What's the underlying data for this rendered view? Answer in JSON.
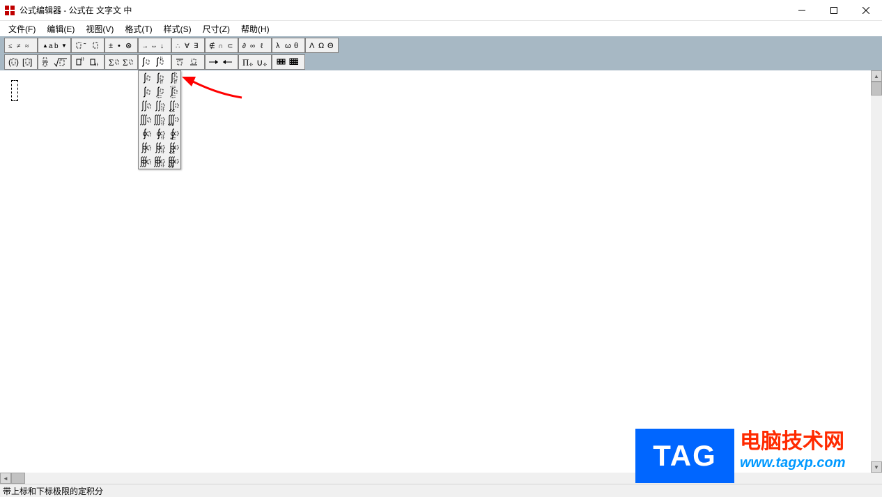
{
  "window": {
    "title": "公式编辑器 - 公式在 文字文 中"
  },
  "menus": {
    "file": "文件(F)",
    "edit": "编辑(E)",
    "view": "视图(V)",
    "format": "格式(T)",
    "style": "样式(S)",
    "size": "尺寸(Z)",
    "help": "帮助(H)"
  },
  "status": {
    "text": "带上标和下标极限的定积分"
  },
  "watermark": {
    "tag": "TAG",
    "line1": "电脑技术网",
    "line2": "www.tagxp.com"
  },
  "toolbars": {
    "row1": [
      "relational-symbols",
      "spacing-ellipsis",
      "embellishments",
      "operators",
      "arrows",
      "logical",
      "set-theory",
      "misc-symbols",
      "greek-lower",
      "greek-upper"
    ],
    "row2": [
      "fences",
      "fractions-radicals",
      "sub-sup",
      "summation",
      "integrals",
      "over-under-bar",
      "arrows-labeled",
      "products",
      "matrices"
    ]
  },
  "dropdown": {
    "open_index": 4,
    "name": "integrals-palette"
  }
}
